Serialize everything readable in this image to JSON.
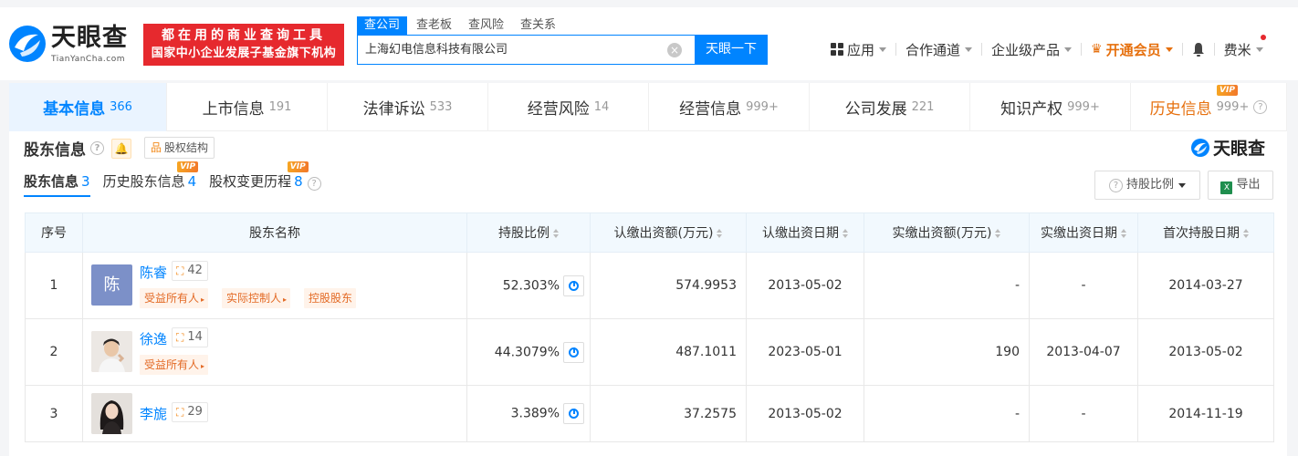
{
  "header": {
    "logo_text": "天眼查",
    "logo_sub": "TianYanCha.com",
    "slogan_line1": "都在用的商业查询工具",
    "slogan_line2": "国家中小企业发展子基金旗下机构",
    "search_tabs": [
      "查公司",
      "查老板",
      "查风险",
      "查关系"
    ],
    "search_value": "上海幻电信息科技有限公司",
    "search_button": "天眼一下",
    "nav": {
      "apps": "应用",
      "partner": "合作通道",
      "enterprise": "企业级产品",
      "vip": "开通会员",
      "user": "费米"
    }
  },
  "tabs": [
    {
      "label": "基本信息",
      "count": "366"
    },
    {
      "label": "上市信息",
      "count": "191"
    },
    {
      "label": "法律诉讼",
      "count": "533"
    },
    {
      "label": "经营风险",
      "count": "14"
    },
    {
      "label": "经营信息",
      "count": "999+"
    },
    {
      "label": "公司发展",
      "count": "221"
    },
    {
      "label": "知识产权",
      "count": "999+"
    },
    {
      "label": "历史信息",
      "count": "999+"
    }
  ],
  "vip_label": "VIP",
  "section": {
    "title": "股东信息",
    "struct_btn": "股权结构",
    "brand": "天眼查",
    "subtabs": [
      {
        "label": "股东信息",
        "count": "3"
      },
      {
        "label": "历史股东信息",
        "count": "4"
      },
      {
        "label": "股权变更历程",
        "count": "8"
      }
    ],
    "ratio_btn": "持股比例",
    "export_btn": "导出"
  },
  "table": {
    "headers": [
      "序号",
      "股东名称",
      "持股比例",
      "认缴出资额(万元)",
      "认缴出资日期",
      "实缴出资额(万元)",
      "实缴出资日期",
      "首次持股日期"
    ],
    "rows": [
      {
        "no": "1",
        "avatar": "陈",
        "name": "陈睿",
        "relations": "42",
        "tags": [
          "受益所有人",
          "实际控制人",
          "控股股东"
        ],
        "ratio": "52.303%",
        "subscribed": "574.9953",
        "subscribed_date": "2013-05-02",
        "paid": "-",
        "paid_date": "-",
        "first_date": "2014-03-27"
      },
      {
        "no": "2",
        "avatar": "",
        "name": "徐逸",
        "relations": "14",
        "tags": [
          "受益所有人"
        ],
        "ratio": "44.3079%",
        "subscribed": "487.1011",
        "subscribed_date": "2023-05-01",
        "paid": "190",
        "paid_date": "2013-04-07",
        "first_date": "2013-05-02"
      },
      {
        "no": "3",
        "avatar": "",
        "name": "李旎",
        "relations": "29",
        "tags": [],
        "ratio": "3.389%",
        "subscribed": "37.2575",
        "subscribed_date": "2013-05-02",
        "paid": "-",
        "paid_date": "-",
        "first_date": "2014-11-19"
      }
    ]
  },
  "colors": {
    "brand_blue": "#0084ff",
    "brand_red": "#e6292e",
    "accent_orange": "#e6700e"
  }
}
